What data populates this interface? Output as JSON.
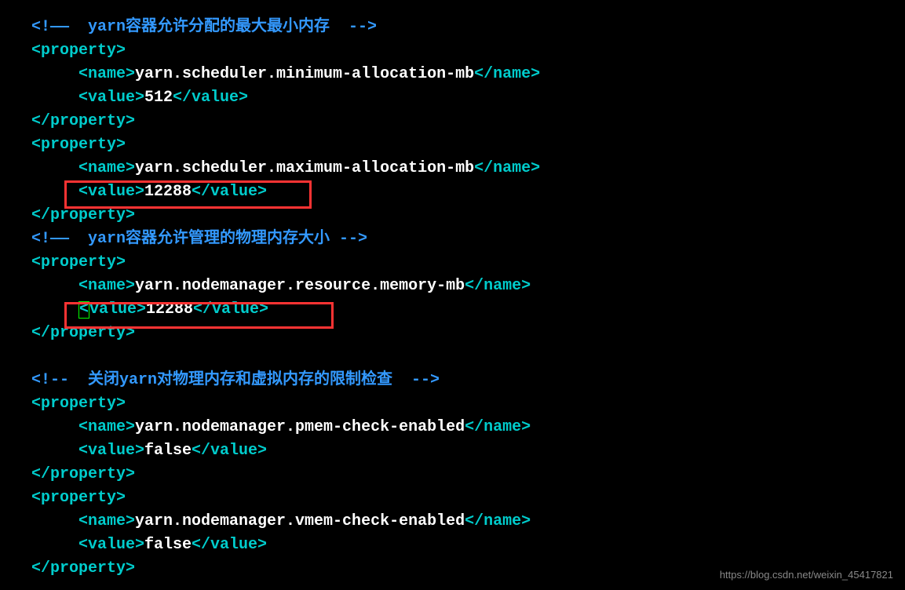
{
  "comments": {
    "c1_open": "<!——",
    "c1_text": "  yarn容器允许分配的最大最小内存  ",
    "c1_close": "-->",
    "c2_open": "<!——",
    "c2_text": "  yarn容器允许管理的物理内存大小 ",
    "c2_close": "-->",
    "c3_open": "<!--",
    "c3_text": "  关闭yarn对物理内存和虚拟内存的限制检查  ",
    "c3_close": "-->"
  },
  "tags": {
    "property_open": "<property>",
    "property_close": "</property>",
    "name_open": "<name>",
    "name_close": "</name>",
    "value_open": "<value>",
    "value_open_cursor_lt": "<",
    "value_open_cursor_rest": "value>",
    "value_close": "</value>"
  },
  "props": {
    "p1_name": "yarn.scheduler.minimum-allocation-mb",
    "p1_value": "512",
    "p2_name": "yarn.scheduler.maximum-allocation-mb",
    "p2_value": "12288",
    "p3_name": "yarn.nodemanager.resource.memory-mb",
    "p3_value": "12288",
    "p4_name": "yarn.nodemanager.pmem-check-enabled",
    "p4_value": "false",
    "p5_name": "yarn.nodemanager.vmem-check-enabled",
    "p5_value": "false"
  },
  "watermark": "https://blog.csdn.net/weixin_45417821"
}
